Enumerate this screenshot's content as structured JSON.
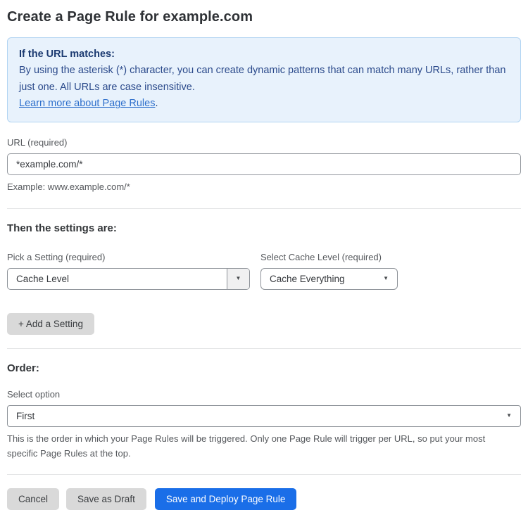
{
  "page": {
    "title": "Create a Page Rule for example.com"
  },
  "info_box": {
    "heading": "If the URL matches:",
    "body": "By using the asterisk (*) character, you can create dynamic patterns that can match many URLs, rather than just one. All URLs are case insensitive.",
    "link_label": "Learn more about Page Rules",
    "link_suffix": "."
  },
  "url_field": {
    "label": "URL (required)",
    "value": "*example.com/*",
    "helper": "Example: www.example.com/*"
  },
  "settings_section": {
    "heading": "Then the settings are:",
    "setting_picker": {
      "label": "Pick a Setting (required)",
      "value": "Cache Level"
    },
    "cache_level_picker": {
      "label": "Select Cache Level (required)",
      "value": "Cache Everything"
    },
    "add_setting_button": "+ Add a Setting"
  },
  "order_section": {
    "heading": "Order:",
    "label": "Select option",
    "value": "First",
    "helper": "This is the order in which your Page Rules will be triggered. Only one Page Rule will trigger per URL, so put your most specific Page Rules at the top."
  },
  "footer": {
    "cancel_label": "Cancel",
    "save_draft_label": "Save as Draft",
    "save_deploy_label": "Save and Deploy Page Rule"
  },
  "icons": {
    "dropdown_caret": "▼"
  },
  "colors": {
    "accent_blue": "#1a6ee8",
    "info_bg": "#e8f2fc",
    "info_border": "#b2d4f2",
    "info_text": "#2b4a8b",
    "link_blue": "#2c6ecb",
    "button_gray": "#d9d9d9"
  }
}
